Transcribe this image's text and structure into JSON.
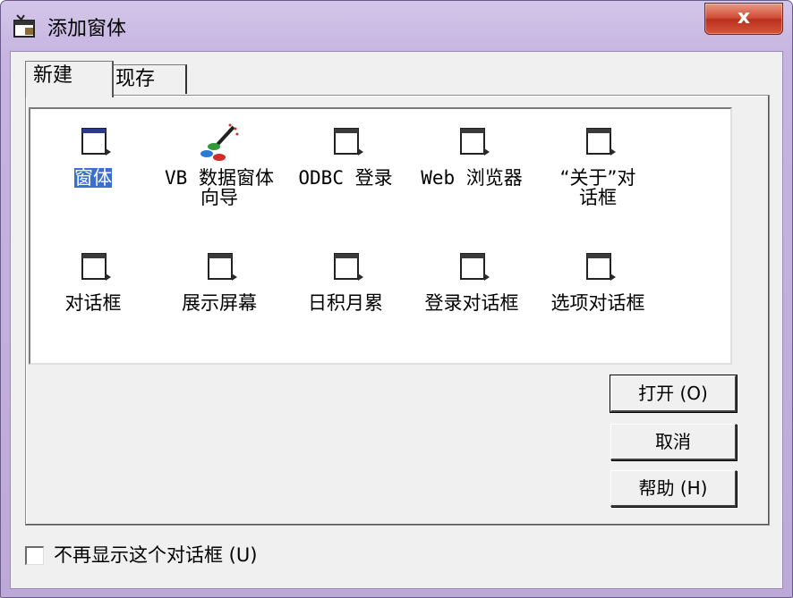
{
  "window": {
    "title": "添加窗体",
    "close_label": "x"
  },
  "tabs": [
    {
      "label": "新建",
      "active": true
    },
    {
      "label": "现存",
      "active": false
    }
  ],
  "items": [
    {
      "label": "窗体",
      "icon": "form-icon",
      "selected": true
    },
    {
      "label": "VB 数据窗体\n向导",
      "icon": "wizard-icon",
      "selected": false
    },
    {
      "label": "ODBC 登录",
      "icon": "form-icon",
      "selected": false
    },
    {
      "label": "Web 浏览器",
      "icon": "form-icon",
      "selected": false
    },
    {
      "label": "“关于”对\n话框",
      "icon": "form-icon",
      "selected": false
    },
    {
      "label": "对话框",
      "icon": "form-icon",
      "selected": false
    },
    {
      "label": "展示屏幕",
      "icon": "form-icon",
      "selected": false
    },
    {
      "label": "日积月累",
      "icon": "form-icon",
      "selected": false
    },
    {
      "label": "登录对话框",
      "icon": "form-icon",
      "selected": false
    },
    {
      "label": "选项对话框",
      "icon": "form-icon",
      "selected": false
    }
  ],
  "buttons": {
    "open": "打开 (O)",
    "cancel": "取消",
    "help": "帮助 (H)"
  },
  "checkbox": {
    "label": "不再显示这个对话框 (U)",
    "checked": false
  },
  "colors": {
    "selection": "#3a6fd0",
    "title_bar": "#c6b5e0",
    "close_button": "#cf4a33"
  }
}
